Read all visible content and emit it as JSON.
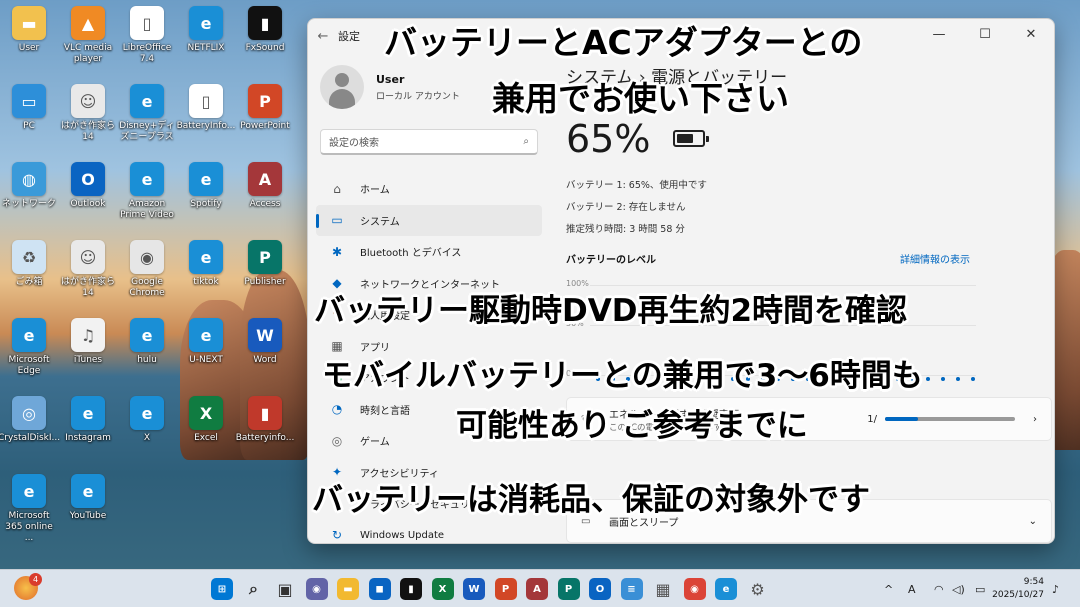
{
  "desktop": {
    "icons": [
      {
        "label": "User",
        "glyph": "▬",
        "color": "#f2c14e"
      },
      {
        "label": "VLC media player",
        "glyph": "▲",
        "color": "#f08a24"
      },
      {
        "label": "LibreOffice 7.4",
        "glyph": "▯",
        "color": "#ffffff"
      },
      {
        "label": "NETFLIX",
        "glyph": "e",
        "color": "#1a8fd6"
      },
      {
        "label": "FxSound",
        "glyph": "▮",
        "color": "#111111"
      },
      {
        "label": "PC",
        "glyph": "▭",
        "color": "#2d8fd9"
      },
      {
        "label": "はがき作家ら 14",
        "glyph": "☺",
        "color": "#e9e9e9"
      },
      {
        "label": "Disney+ディズニープラス",
        "glyph": "e",
        "color": "#1a8fd6"
      },
      {
        "label": "BatteryInfo...",
        "glyph": "▯",
        "color": "#ffffff"
      },
      {
        "label": "PowerPoint",
        "glyph": "P",
        "color": "#d24726"
      },
      {
        "label": "ネットワーク",
        "glyph": "◍",
        "color": "#3a9ad9"
      },
      {
        "label": "Outlook",
        "glyph": "O",
        "color": "#0a64c2"
      },
      {
        "label": "Amazon Prime Video",
        "glyph": "e",
        "color": "#1a8fd6"
      },
      {
        "label": "Spotify",
        "glyph": "e",
        "color": "#1a8fd6"
      },
      {
        "label": "Access",
        "glyph": "A",
        "color": "#a4373a"
      },
      {
        "label": "ごみ箱",
        "glyph": "♻",
        "color": "#cfe3f3"
      },
      {
        "label": "はがき作家ら 14",
        "glyph": "☺",
        "color": "#e9e9e9"
      },
      {
        "label": "Google Chrome",
        "glyph": "◉",
        "color": "#e6e6e6"
      },
      {
        "label": "tiktok",
        "glyph": "e",
        "color": "#1a8fd6"
      },
      {
        "label": "Publisher",
        "glyph": "P",
        "color": "#077568"
      },
      {
        "label": "Microsoft Edge",
        "glyph": "e",
        "color": "#1a8fd6"
      },
      {
        "label": "iTunes",
        "glyph": "♫",
        "color": "#f2f2f2"
      },
      {
        "label": "hulu",
        "glyph": "e",
        "color": "#1a8fd6"
      },
      {
        "label": "U-NEXT",
        "glyph": "e",
        "color": "#1a8fd6"
      },
      {
        "label": "Word",
        "glyph": "W",
        "color": "#185abd"
      },
      {
        "label": "CrystalDiskI...",
        "glyph": "◎",
        "color": "#6fa7d8"
      },
      {
        "label": "Instagram",
        "glyph": "e",
        "color": "#1a8fd6"
      },
      {
        "label": "X",
        "glyph": "e",
        "color": "#1a8fd6"
      },
      {
        "label": "Excel",
        "glyph": "X",
        "color": "#107c41"
      },
      {
        "label": "Batteryinfo...",
        "glyph": "▮",
        "color": "#c0392b"
      },
      {
        "label": "Microsoft 365 online ...",
        "glyph": "e",
        "color": "#1a8fd6"
      },
      {
        "label": "YouTube",
        "glyph": "e",
        "color": "#1a8fd6"
      }
    ]
  },
  "window": {
    "title": "設定",
    "back": "←",
    "minimize": "—",
    "maximize": "☐",
    "close": "✕",
    "user": {
      "name": "User",
      "account": "ローカル アカウント"
    },
    "search_placeholder": "設定の検索",
    "search_icon": "⌕",
    "nav": [
      {
        "label": "ホーム",
        "icon": "⌂",
        "color": "#555555"
      },
      {
        "label": "システム",
        "icon": "▭",
        "color": "#0067c0",
        "selected": true
      },
      {
        "label": "Bluetooth とデバイス",
        "icon": "✱",
        "color": "#0067c0"
      },
      {
        "label": "ネットワークとインターネット",
        "icon": "◆",
        "color": "#0067c0"
      },
      {
        "label": "個人用設定",
        "icon": "✎",
        "color": "#b06030"
      },
      {
        "label": "アプリ",
        "icon": "▦",
        "color": "#555555"
      },
      {
        "label": "アカウント",
        "icon": "●",
        "color": "#2aa55a"
      },
      {
        "label": "時刻と言語",
        "icon": "◔",
        "color": "#0067c0"
      },
      {
        "label": "ゲーム",
        "icon": "◎",
        "color": "#666666"
      },
      {
        "label": "アクセシビリティ",
        "icon": "✦",
        "color": "#0067c0"
      },
      {
        "label": "プライバシーとセキュリティ",
        "icon": "◈",
        "color": "#666666"
      },
      {
        "label": "Windows Update",
        "icon": "↻",
        "color": "#0067c0"
      }
    ],
    "breadcrumb": "システム  ›  電源とバッテリー",
    "percent": "65%",
    "battery_level_fraction": 0.65,
    "battery1": "バッテリー 1: 65%、使用中です",
    "battery2": "バッテリー 2: 存在しません",
    "remaining": "推定残り時間: 3 時間 58 分",
    "level_heading": "バッテリーのレベル",
    "detail_link": "詳細情報の表示",
    "chart_ticks": [
      "100%",
      "50%",
      "0%"
    ],
    "energy_card": {
      "title": "エネルギーに関する推奨事項",
      "sub": "このPCの電力使用量を減らす"
    },
    "energy_value": "1/",
    "slider_fraction": 0.25,
    "screen_card": {
      "title": "画面とスリープ"
    },
    "chevron_right": "›",
    "chevron_down": "⌄"
  },
  "overlay": {
    "line1": "バッテリーとACアダプターとの",
    "line2": "兼用でお使い下さい",
    "line3": "バッテリー駆動時DVD再生約2時間を確認",
    "line4": "モバイルバッテリーとの兼用で3～6時間も",
    "line5": "可能性あり ご参考までに",
    "line6": "バッテリーは消耗品、保証の対象外です"
  },
  "taskbar": {
    "notification_badge": "4",
    "apps": [
      {
        "name": "start",
        "glyph": "⊞",
        "color": "#0078d4"
      },
      {
        "name": "search",
        "glyph": "⌕",
        "color": "#333333"
      },
      {
        "name": "task-view",
        "glyph": "▣",
        "color": "#333333"
      },
      {
        "name": "teams",
        "glyph": "◉",
        "color": "#6264a7"
      },
      {
        "name": "explorer",
        "glyph": "▬",
        "color": "#f2b930"
      },
      {
        "name": "store",
        "glyph": "◼",
        "color": "#0a64c2"
      },
      {
        "name": "fxsound",
        "glyph": "▮",
        "color": "#111111"
      },
      {
        "name": "excel",
        "glyph": "X",
        "color": "#107c41"
      },
      {
        "name": "word",
        "glyph": "W",
        "color": "#185abd"
      },
      {
        "name": "powerpoint",
        "glyph": "P",
        "color": "#d24726"
      },
      {
        "name": "access",
        "glyph": "A",
        "color": "#a4373a"
      },
      {
        "name": "publisher",
        "glyph": "P",
        "color": "#077568"
      },
      {
        "name": "outlook",
        "glyph": "O",
        "color": "#0a64c2"
      },
      {
        "name": "notepad",
        "glyph": "≡",
        "color": "#3a8fd6"
      },
      {
        "name": "calculator",
        "glyph": "▦",
        "color": "#555555"
      },
      {
        "name": "chrome",
        "glyph": "◉",
        "color": "#db4437"
      },
      {
        "name": "edge",
        "glyph": "e",
        "color": "#1a8fd6"
      },
      {
        "name": "settings",
        "glyph": "⚙",
        "color": "#555555"
      }
    ],
    "tray_chevron": "^",
    "ime": "A",
    "wifi": "◠",
    "volume": "◁)",
    "battery": "▭",
    "time": "9:54",
    "date": "2025/10/27",
    "bell": "♪"
  }
}
